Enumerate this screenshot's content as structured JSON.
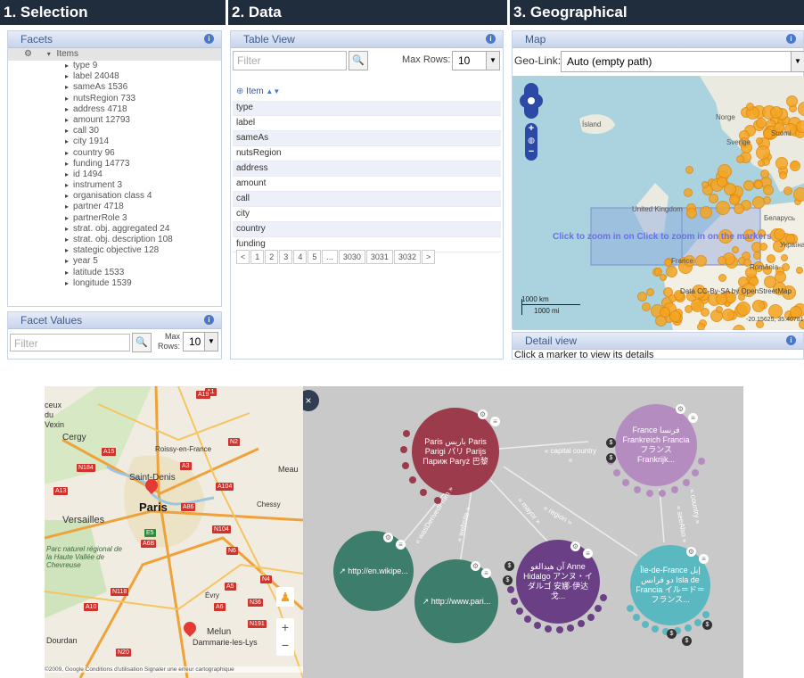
{
  "sections": {
    "selection": "1. Selection",
    "data": "2. Data",
    "geo": "3. Geographical"
  },
  "facets": {
    "title": "Facets",
    "root": "Items",
    "items": [
      "type 9",
      "label 24048",
      "sameAs 1536",
      "nutsRegion 733",
      "address 4718",
      "amount 12793",
      "call 30",
      "city 1914",
      "country 96",
      "funding 14773",
      "id 1494",
      "instrument 3",
      "organisation class 4",
      "partner 4718",
      "partnerRole 3",
      "strat. obj. aggregated 24",
      "strat. obj. description 108",
      "stategic objective 128",
      "year 5",
      "latitude 1533",
      "longitude 1539"
    ]
  },
  "facet_values": {
    "title": "Facet Values",
    "filter_placeholder": "Filter",
    "max_rows_label": "Max Rows:",
    "max_rows": "10"
  },
  "table_view": {
    "title": "Table View",
    "filter_placeholder": "Filter",
    "max_rows_label": "Max Rows:",
    "max_rows": "10",
    "header": "Item",
    "rows": [
      "type",
      "label",
      "sameAs",
      "nutsRegion",
      "address",
      "amount",
      "call",
      "city",
      "country",
      "funding"
    ],
    "pages": [
      "<",
      "1",
      "2",
      "3",
      "4",
      "5",
      "...",
      "3030",
      "3031",
      "3032",
      ">"
    ]
  },
  "map": {
    "title": "Map",
    "geolink_label": "Geo-Link:",
    "geolink_value": "Auto (empty path)",
    "labels": [
      "Ísland",
      "Norge",
      "Suomi",
      "Sverige",
      "United Kingdom",
      "Беларусь",
      "France",
      "România",
      "Україна"
    ],
    "zoom_text": "Click to zoom in on  Click to zoom in on the markers",
    "scale_km": "1000 km",
    "scale_mi": "1000 mi",
    "attribution": "Data CC-By-SA by OpenStreetMap",
    "coords": "-20.15625, 35.40781"
  },
  "detail_view": {
    "title": "Detail view",
    "text": "Click a marker to view its details"
  },
  "paris_map": {
    "labels": [
      "Cergy",
      "Roissy-en-France",
      "Saint-Denis",
      "Paris",
      "Chessy",
      "Versailles",
      "Parc naturel régional de la Haute Vallée de Chevreuse",
      "Évry",
      "Melun",
      "Dammarie-les-Lys",
      "Dourdan",
      "Meau",
      "ceux",
      "du",
      "Vexin"
    ],
    "roads": [
      "A1",
      "A15",
      "N184",
      "A3",
      "N2",
      "A13",
      "A104",
      "A86",
      "E5",
      "N104",
      "A6B",
      "N6",
      "A5",
      "N36",
      "N4",
      "N20",
      "A10",
      "N118",
      "A6",
      "N191",
      "A19"
    ],
    "attribution": "©2009, Google  Conditions d'utilisation  Signaler une erreur cartographique"
  },
  "graph": {
    "close": "×",
    "nodes": {
      "paris": "Paris باريس Paris Parigi パリ Parijs Париж Paryż 巴黎",
      "france": "France فرنسا Frankreich Francia フランス Frankrijk...",
      "wiki": "↗ http://en.wikipe...",
      "parisweb": "↗ http://www.pari...",
      "hidalgo": "آن هيدالغو Anne Hidalgo アンヌ・イダルゴ 安娜·伊达戈...",
      "idf": "Île-de-France إيل دو فرانس Isla de Francia イル＝ド＝フランス..."
    },
    "edges": [
      "« capital country »",
      "« wasDerivedFrom »",
      "« website »",
      "« mayor »",
      "« region »",
      "« country »",
      "« seeAlso »"
    ],
    "colors": {
      "paris": "#9c3b4b",
      "france": "#b48cc0",
      "green": "#3d7d6c",
      "purple": "#6a3f86",
      "teal": "#5ab8c0"
    }
  }
}
